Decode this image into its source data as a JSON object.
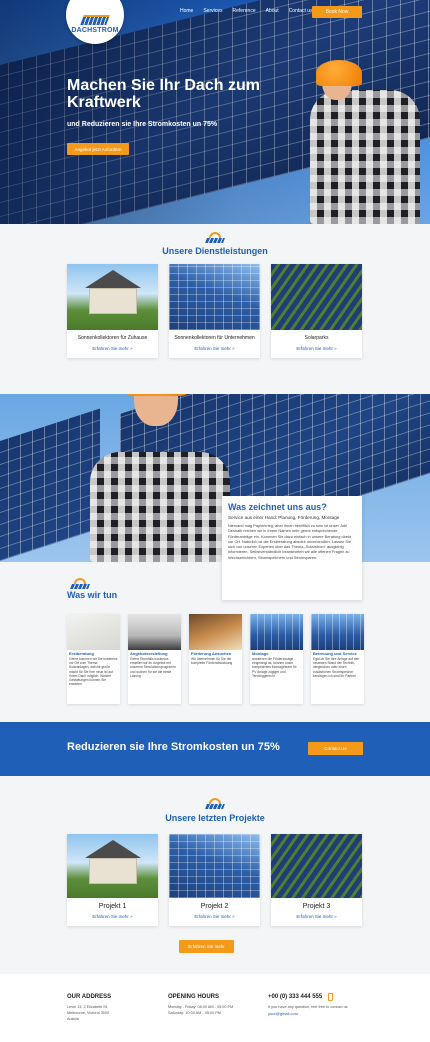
{
  "header": {
    "logo_text": "DACHSTROM",
    "nav": [
      "Home",
      "Services",
      "Reference",
      "About",
      "Contact us"
    ],
    "book_label": "Book Now"
  },
  "hero": {
    "title": "Machen Sie Ihr Dach zum Kraftwerk",
    "subtitle": "und Reduzieren sie Ihre Stromkosten un 75%",
    "button": "Angebot jetzt Anfordern"
  },
  "services": {
    "title": "Unsere Dienstleistungen",
    "cards": [
      {
        "title": "Sonnenkollektoren für Zuhause",
        "link": "Erfahren Sie mehr »"
      },
      {
        "title": "Sonnenkollektoren für Unternehmen",
        "link": "Erfahren Sie mehr »"
      },
      {
        "title": "Solarparks",
        "link": "Erfahren Sie mehr »"
      }
    ]
  },
  "why": {
    "title": "Was zeichnet uns aus?",
    "subtitle": "Service aus einer Hand: Planung, Förderung, Montage",
    "text": "Niemand mag Papierkrieg, aber ihnen behilflich zu sein ist unser Job! Deshalb reichen wir in Ihrem Namen sehr gerne entsprechende Förderanträge ein. Kommen Sie dazu einfach in unsere Beratung direkt vor Ort. Natürlich ist die Erstberatung absolut unverbindlich. Lassen Sie sich von unseren Experten über das Thema „Solarstrom“ ausgiebig informieren. Selbstverständlich beantworten wir alle offenen Fragen zu Wechselrichtern, Stromspeichern und Stromsparen."
  },
  "what": {
    "title": "Was wir tun",
    "items": [
      {
        "title": "Erstberatung",
        "text": "Gerne kommen wir Sie kostenlos vor Ort zum Thema Solaranlagen, welche große macht für Sie Ihre neue ist auf Ihrem Dach möglich. Welche Gestaltungen können Sie erwarten"
      },
      {
        "title": "Angebotserstellung",
        "text": "Gerne Ebenfalls kostenlos erstellen wir Ihr Angebot mit unserem Simulationsprogramm und suchen für sie die beste Lösung"
      },
      {
        "title": "Förderung Ansuchen",
        "text": "Wir übernehmen für Sie die komplette Förderabwicklung"
      },
      {
        "title": "Montage",
        "text": "montieren die Förderzusage eingelangt ist, können unser kompetentes Montageteam für PV Anlage zügiger und Terminggerecht"
      },
      {
        "title": "Betreuung und Service",
        "text": "Egal ob Sie Ihre Anlage auf den neuesten Stand der Technik, dergleichen oder einen zusätzlichen Stromspeicher benötigen ich sind Ihr Partner"
      }
    ]
  },
  "banner": {
    "text": "Reduzieren sie Ihre Stromkosten un 75%",
    "button": "Contact Us"
  },
  "projects": {
    "title": "Unsere letzten Projekte",
    "cards": [
      {
        "title": "Projekt 1",
        "link": "Erfahren Sie mehr »"
      },
      {
        "title": "Projekt 2",
        "link": "Erfahren Sie mehr »"
      },
      {
        "title": "Projekt 3",
        "link": "Erfahren Sie mehr »"
      }
    ],
    "more_button": "Erfahren Sie mehr"
  },
  "footer": {
    "address_title": "OUR ADDRESS",
    "address_lines": [
      "Level 13, 2 Elizabeth St,",
      "Melbourne, Victoria 3000",
      "Austria"
    ],
    "hours_title": "OPENING HOURS",
    "hours_lines": [
      "Monday - Friday: 08:00 AM - 05:00 PM",
      "Saturday: 10:00 AM - 05:00 PM"
    ],
    "phone": "+00 (0) 333 444 555",
    "phone_note": "If you have any question, feel free to contact us",
    "email": "your@gmail.com"
  },
  "colors": {
    "primary": "#1f5fb8",
    "accent": "#f39a1a",
    "light_bg": "#f4f5f7"
  }
}
